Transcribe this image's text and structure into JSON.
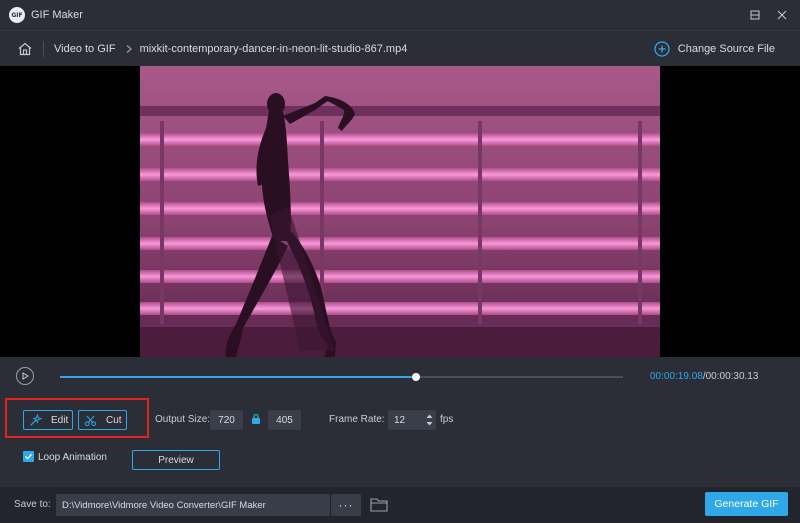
{
  "window": {
    "app_title": "GIF Maker",
    "logo_text": "GIF"
  },
  "nav": {
    "breadcrumb_root": "Video to GIF",
    "file_name": "mixkit-contemporary-dancer-in-neon-lit-studio-867.mp4",
    "change_source_label": "Change Source File"
  },
  "player": {
    "current_time": "00:00:19.08",
    "total_time": "/00:00:30.13",
    "progress": 0.633
  },
  "tools": {
    "edit_label": "Edit",
    "cut_label": "Cut"
  },
  "output": {
    "size_label": "Output Size:",
    "width": "720",
    "height": "405",
    "frame_rate_label": "Frame Rate:",
    "frame_rate": "12",
    "fps_label": "fps"
  },
  "options": {
    "loop_label": "Loop Animation",
    "loop_checked": true,
    "preview_label": "Preview"
  },
  "footer": {
    "save_label": "Save to:",
    "save_path": "D:\\Vidmore\\Vidmore Video Converter\\GIF Maker",
    "more_label": "···",
    "generate_label": "Generate GIF"
  },
  "colors": {
    "accent": "#2ea8e6",
    "highlight": "#e02424",
    "neon": "#d966ad"
  }
}
